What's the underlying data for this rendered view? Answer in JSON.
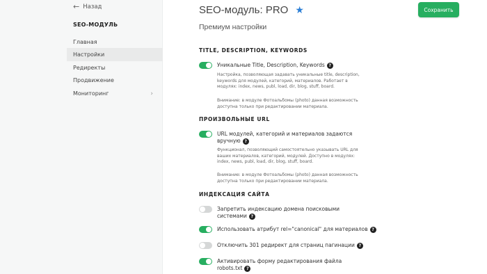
{
  "sidebar": {
    "back_label": "Назад",
    "module_title": "SEO-МОДУЛЬ",
    "items": [
      {
        "label": "Главная"
      },
      {
        "label": "Настройки"
      },
      {
        "label": "Редиректы"
      },
      {
        "label": "Продвижение"
      },
      {
        "label": "Мониторинг"
      }
    ]
  },
  "header": {
    "title": "SEO-модуль: PRO",
    "subtitle": "Премиум настройки",
    "save_label": "Сохранить",
    "star_icon": "star-icon"
  },
  "colors": {
    "accent": "#27ae60",
    "star": "#2c7fd6"
  },
  "sections": {
    "tdk": {
      "heading": "TITLE, DESCRIPTION, KEYWORDS",
      "option_label": "Уникальные Title, Description, Keywords",
      "option_on": true,
      "desc1": [
        "Настройка, позволяющая задавать уникальные title, description,",
        "keywords для модулей, категорий, материалов. Работает в",
        "модулях: index, news, publ, load, dir, blog, stuff, board."
      ],
      "desc2": [
        "Внимание: в модуле Фотоальбомы (photo) данная возможность",
        "доступна только при редактировании материала."
      ]
    },
    "url": {
      "heading": "ПРОИЗВОЛЬНЫЕ URL",
      "option_label": [
        "URL модулей, категорий и материалов задаются",
        "вручную"
      ],
      "option_on": true,
      "desc1": [
        "Функционал, позволяющий самостоятельно указывать URL для",
        "ваших материалов, категорий, модулей. Доступно в модулях:",
        "index, news, publ, load, dir, blog, stuff, board."
      ],
      "desc2": [
        "Внимание: в модуле Фотоальбомы (photo) данная возможность",
        "доступна только при редактировании материала."
      ]
    },
    "index": {
      "heading": "ИНДЕКСАЦИЯ САЙТА",
      "options": [
        {
          "label": [
            "Запретить индексацию домена поисковыми",
            "системами"
          ],
          "on": false
        },
        {
          "label": [
            "Использовать атрибут rel=\"canonical\" для материалов"
          ],
          "on": true
        },
        {
          "label": [
            "Отключить 301 редирект для страниц пагинации"
          ],
          "on": false
        },
        {
          "label": [
            "Активировать форму редактирования файла",
            "robots.txt"
          ],
          "on": true
        }
      ]
    }
  },
  "help_glyph": "?"
}
